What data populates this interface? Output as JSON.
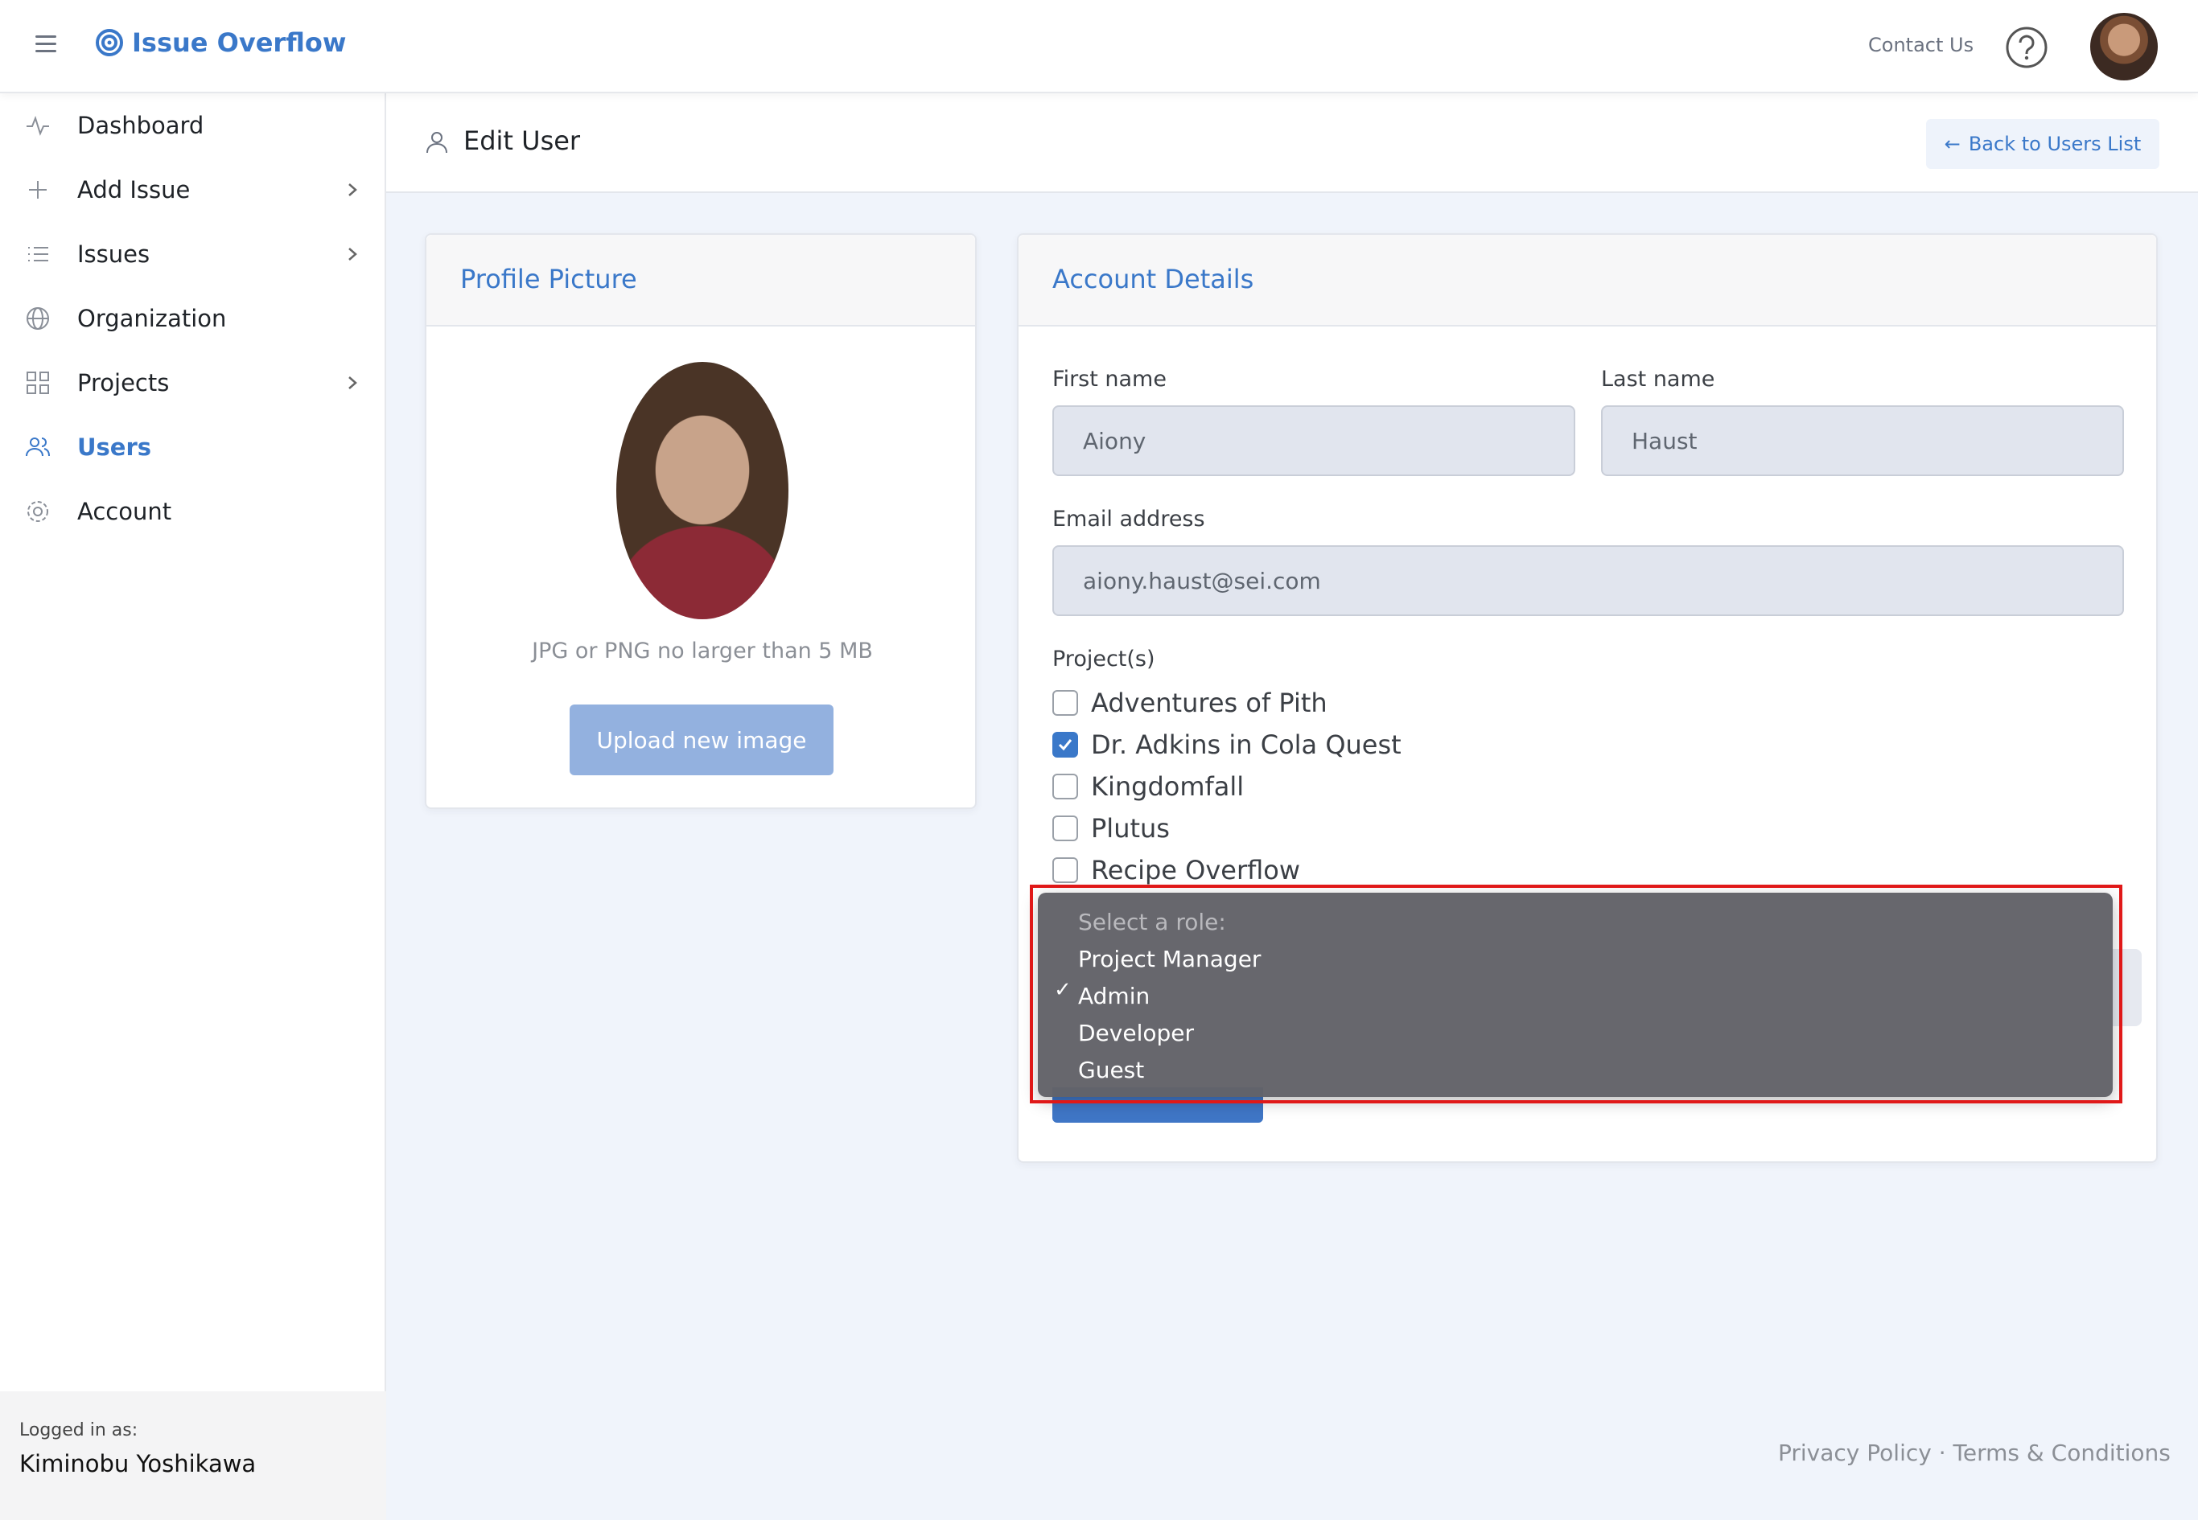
{
  "brand": {
    "name": "Issue Overflow"
  },
  "topbar": {
    "contact": "Contact Us"
  },
  "nav": [
    {
      "label": "Dashboard"
    },
    {
      "label": "Add Issue"
    },
    {
      "label": "Issues"
    },
    {
      "label": "Organization"
    },
    {
      "label": "Projects"
    },
    {
      "label": "Users"
    },
    {
      "label": "Account"
    }
  ],
  "sidebar_footer": {
    "label": "Logged in as:",
    "name": "Kiminobu Yoshikawa"
  },
  "page": {
    "title": "Edit User",
    "back_label": "Back to Users List"
  },
  "profile": {
    "title": "Profile Picture",
    "note": "JPG or PNG no larger than 5 MB",
    "upload_label": "Upload new image"
  },
  "account": {
    "title": "Account Details",
    "first_name_label": "First name",
    "first_name_value": "Aiony",
    "last_name_label": "Last name",
    "last_name_value": "Haust",
    "email_label": "Email address",
    "email_value": "aiony.haust@sei.com",
    "projects_label": "Project(s)",
    "projects": [
      {
        "label": "Adventures of Pith",
        "checked": false
      },
      {
        "label": "Dr. Adkins in Cola Quest",
        "checked": true
      },
      {
        "label": "Kingdomfall",
        "checked": false
      },
      {
        "label": "Plutus",
        "checked": false
      },
      {
        "label": "Recipe Overflow",
        "checked": false
      }
    ]
  },
  "role_dropdown": {
    "header": "Select a role:",
    "options": [
      "Project Manager",
      "Admin",
      "Developer",
      "Guest"
    ],
    "selected": "Admin"
  },
  "footer": {
    "privacy": "Privacy Policy",
    "separator": "·",
    "terms": "Terms & Conditions"
  },
  "colors": {
    "accent": "#3a78c9",
    "highlight": "#e01818"
  }
}
